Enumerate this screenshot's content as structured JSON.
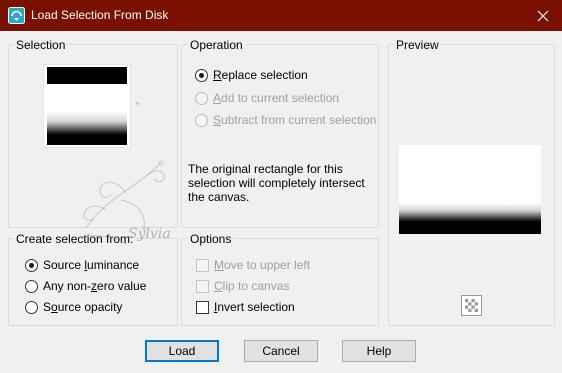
{
  "window": {
    "title": "Load Selection From Disk",
    "titlebar_color": "#7a1100"
  },
  "selection": {
    "group_label": "Selection"
  },
  "operation": {
    "group_label": "Operation",
    "options": [
      {
        "label": "Replace selection",
        "checked": true,
        "enabled": true
      },
      {
        "label": "Add to current selection",
        "checked": false,
        "enabled": false
      },
      {
        "label": "Subtract from current selection",
        "checked": false,
        "enabled": false
      }
    ],
    "info": "The original rectangle for this selection will completely intersect the canvas."
  },
  "preview": {
    "group_label": "Preview"
  },
  "create_from": {
    "group_label": "Create selection from:",
    "options": [
      {
        "label": "Source luminance",
        "checked": true
      },
      {
        "label": "Any non-zero value",
        "checked": false
      },
      {
        "label": "Source opacity",
        "checked": false
      }
    ]
  },
  "options": {
    "group_label": "Options",
    "items": [
      {
        "label": "Move to upper left",
        "checked": false,
        "enabled": false
      },
      {
        "label": "Clip to canvas",
        "checked": false,
        "enabled": false
      },
      {
        "label": "Invert selection",
        "checked": false,
        "enabled": true
      }
    ]
  },
  "watermark": {
    "text": "Sylvia"
  },
  "buttons": {
    "load": "Load",
    "cancel": "Cancel",
    "help": "Help"
  }
}
